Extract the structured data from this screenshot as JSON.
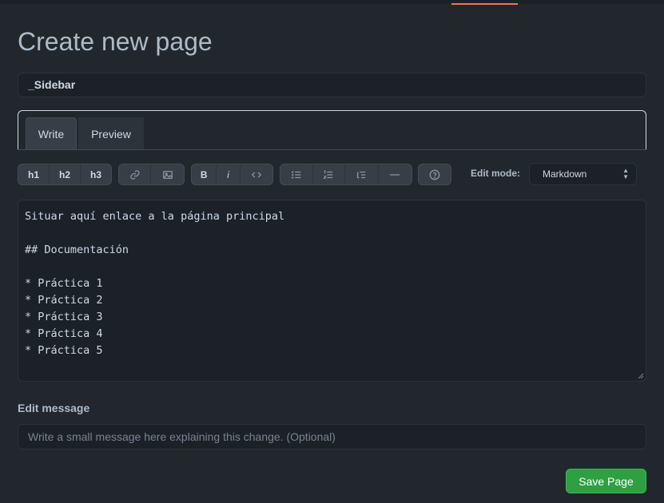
{
  "page": {
    "title": "Create new page"
  },
  "form": {
    "page_name_value": "_Sidebar",
    "tabs": [
      {
        "label": "Write"
      },
      {
        "label": "Preview"
      }
    ],
    "toolbar": {
      "h1": "h1",
      "h2": "h2",
      "h3": "h3",
      "bold": "B",
      "italic": "i",
      "icons": [
        "link-icon",
        "image-icon",
        "code-icon",
        "unordered-list-icon",
        "ordered-list-icon",
        "task-list-icon",
        "horizontal-rule-icon",
        "help-icon"
      ]
    },
    "edit_mode": {
      "label": "Edit mode:",
      "value": "Markdown"
    },
    "content_lines": [
      "Situar aquí enlace a la página principal",
      "",
      "## Documentación",
      "",
      "* Práctica 1",
      "* Práctica 2",
      "* Práctica 3",
      "* Práctica 4",
      "* Práctica 5"
    ],
    "edit_message": {
      "label": "Edit message",
      "placeholder": "Write a small message here explaining this change. (Optional)"
    },
    "save_label": "Save Page"
  },
  "colors": {
    "accent": "#ec775c",
    "save": "#2ea043",
    "background": "#22272e"
  }
}
